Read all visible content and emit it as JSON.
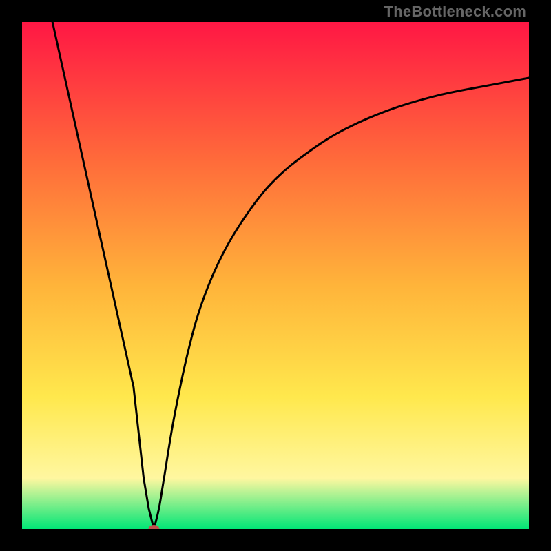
{
  "watermark": "TheBottleneck.com",
  "chart_data": {
    "type": "line",
    "title": "",
    "xlabel": "",
    "ylabel": "",
    "xlim": [
      0,
      100
    ],
    "ylim": [
      0,
      100
    ],
    "gradient_colors": {
      "top": "#ff1744",
      "mid_upper": "#ff6d3a",
      "mid": "#ffb43a",
      "mid_lower": "#ffe84d",
      "near_bottom": "#fff7a0",
      "bottom": "#00e676"
    },
    "marker": {
      "x": 26,
      "y": 0,
      "color": "#c0504d",
      "rx": 8,
      "ry": 6
    },
    "series": [
      {
        "name": "left-segment",
        "x": [
          6,
          10,
          14,
          18,
          22,
          24,
          25,
          26
        ],
        "y": [
          100,
          82,
          64,
          46,
          28,
          10,
          4,
          0
        ]
      },
      {
        "name": "right-segment",
        "x": [
          26,
          27,
          28,
          30,
          33,
          36,
          40,
          45,
          50,
          56,
          63,
          72,
          82,
          92,
          100
        ],
        "y": [
          0,
          4,
          10,
          22,
          36,
          46,
          55,
          63,
          69,
          74,
          78.5,
          82.5,
          85.5,
          87.5,
          89
        ]
      }
    ]
  }
}
